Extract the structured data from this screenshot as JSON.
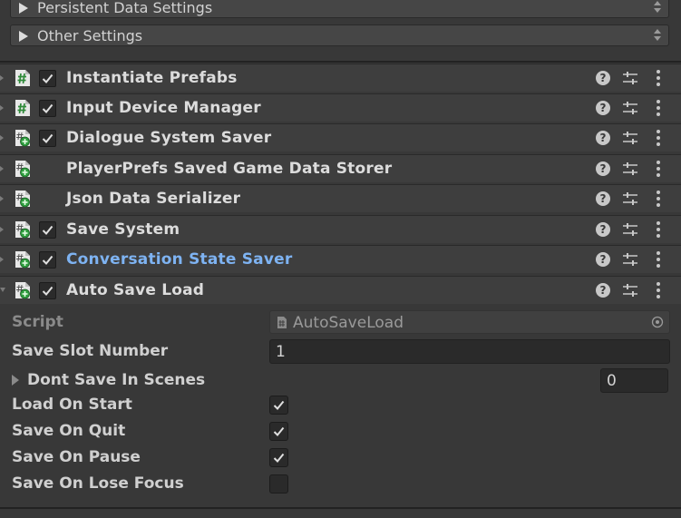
{
  "foldouts": [
    {
      "label": "Persistent Data Settings"
    },
    {
      "label": "Other Settings"
    }
  ],
  "components": [
    {
      "name": "Instantiate Prefabs",
      "icon": "script-hash-icon",
      "enabled": true
    },
    {
      "name": "Input Device Manager",
      "icon": "script-hash-icon",
      "enabled": true
    },
    {
      "name": "Dialogue System Saver",
      "icon": "script-plus-icon",
      "enabled": true
    },
    {
      "name": "PlayerPrefs Saved Game Data Storer",
      "icon": "script-plus-icon",
      "enabled": null
    },
    {
      "name": "Json Data Serializer",
      "icon": "script-plus-icon",
      "enabled": null
    },
    {
      "name": "Save System",
      "icon": "script-plus-icon",
      "enabled": true
    },
    {
      "name": "Conversation State Saver",
      "icon": "script-plus-icon",
      "enabled": true,
      "highlight_color": "#7eb3f2"
    },
    {
      "name": "Auto Save Load",
      "icon": "script-plus-icon",
      "enabled": true,
      "expanded": true
    }
  ],
  "inspector": {
    "script_label": "Script",
    "script_value": "AutoSaveLoad",
    "save_slot_label": "Save Slot Number",
    "save_slot_value": "1",
    "dont_save_label": "Dont Save In Scenes",
    "dont_save_count": "0",
    "load_on_start_label": "Load On Start",
    "load_on_start": true,
    "save_on_quit_label": "Save On Quit",
    "save_on_quit": true,
    "save_on_pause_label": "Save On Pause",
    "save_on_pause": true,
    "save_on_lose_focus_label": "Save On Lose Focus",
    "save_on_lose_focus": false
  },
  "colors": {
    "background": "#383838",
    "header": "#3e3e3e",
    "link_blue": "#7eb3f2"
  }
}
